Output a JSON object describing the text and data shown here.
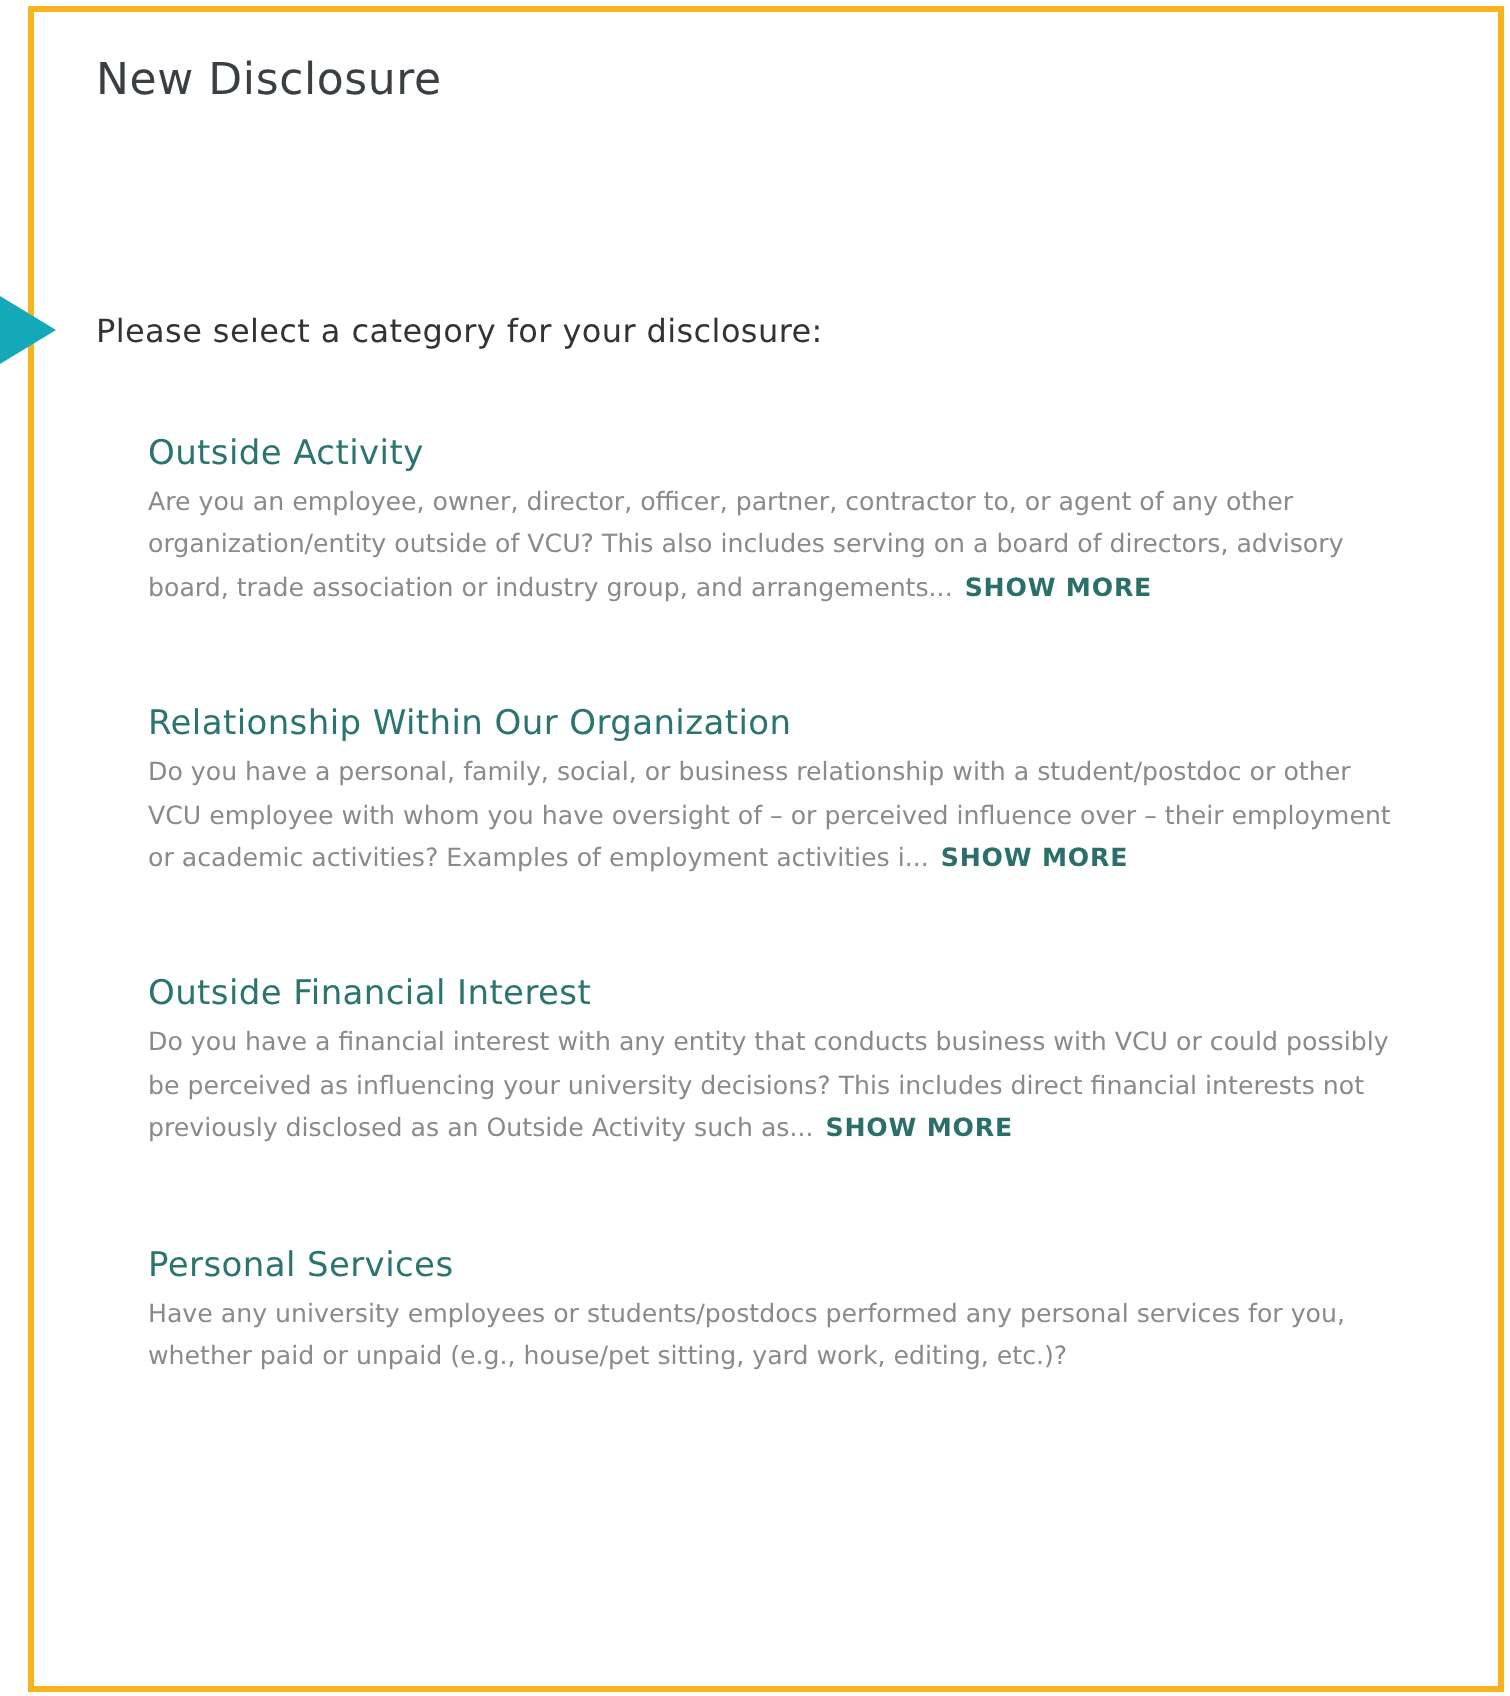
{
  "title": "New Disclosure",
  "prompt": "Please select a category for your disclosure:",
  "categories": [
    {
      "title": "Outside Activity",
      "description": "Are you an employee, owner, director, officer, partner, contractor to, or agent of any other organization/entity outside of VCU? This also includes serving on a board of directors, advisory board, trade association or industry group, and arrangements...",
      "show_more": "SHOW MORE"
    },
    {
      "title": "Relationship Within Our Organization",
      "description": "Do you have a personal, family, social, or business relationship with a student/postdoc or other VCU employee with whom you have oversight of – or perceived influence over – their employment or academic activities? Examples of employment activities i...",
      "show_more": "SHOW MORE"
    },
    {
      "title": "Outside Financial Interest",
      "description": "Do you have a financial interest with any entity that conducts business with VCU or could possibly be perceived as influencing your university decisions? This includes direct financial interests not previously disclosed as an Outside Activity such as...",
      "show_more": "SHOW MORE"
    },
    {
      "title": "Personal Services",
      "description": "Have any university employees or students/postdocs performed any personal services for you, whether paid or unpaid (e.g., house/pet sitting, yard work, editing, etc.)?"
    }
  ]
}
